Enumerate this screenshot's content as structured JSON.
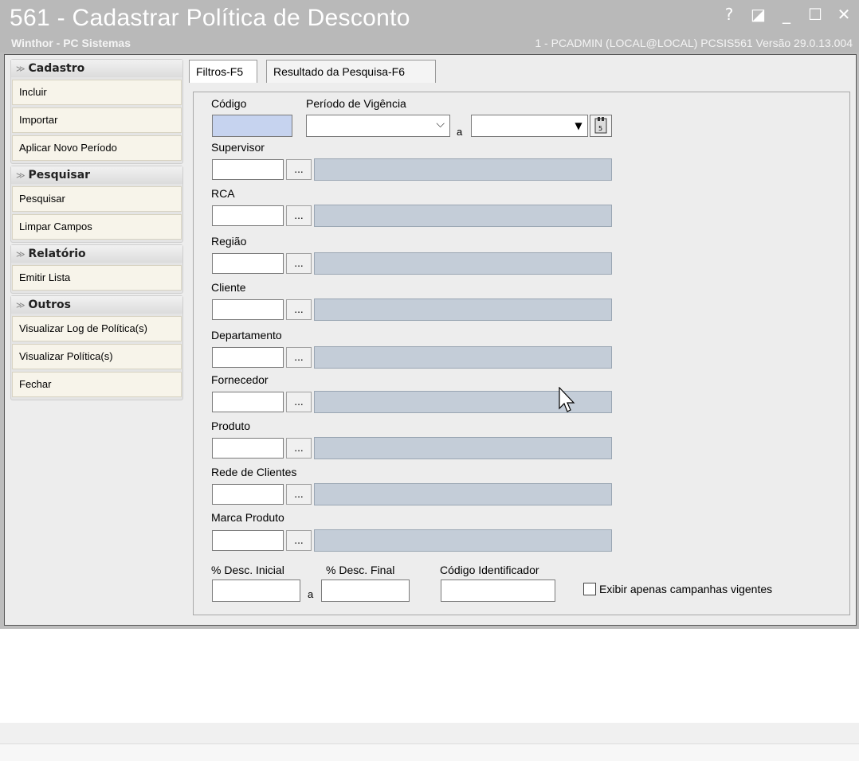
{
  "window": {
    "title": "561 - Cadastrar Política de Desconto",
    "subtitle": "Winthor - PC Sistemas",
    "userinfo": "1 - PCADMIN (LOCAL@LOCAL)   PCSIS561  Versão  29.0.13.004",
    "controls": {
      "help": "?",
      "restore": "◪",
      "minimize": "_",
      "maximize": "☐",
      "close": "✕"
    }
  },
  "sidebar": {
    "groups": [
      {
        "title": "Cadastro",
        "items": [
          "Incluir",
          "Importar",
          "Aplicar Novo Período"
        ]
      },
      {
        "title": "Pesquisar",
        "items": [
          "Pesquisar",
          "Limpar Campos"
        ]
      },
      {
        "title": "Relatório",
        "items": [
          "Emitir Lista"
        ]
      },
      {
        "title": "Outros",
        "items": [
          "Visualizar Log de Política(s)",
          "Visualizar Política(s)",
          "Fechar"
        ]
      }
    ]
  },
  "tabs": [
    {
      "label": "Filtros-F5"
    },
    {
      "label": "Resultado da Pesquisa-F6"
    }
  ],
  "filters": {
    "codigo_label": "Código",
    "periodo_label": "Período de Vigência",
    "periodo_sep": "a",
    "lookups": [
      {
        "label": "Supervisor"
      },
      {
        "label": "RCA"
      },
      {
        "label": "Região"
      },
      {
        "label": "Cliente"
      },
      {
        "label": "Departamento"
      },
      {
        "label": "Fornecedor"
      },
      {
        "label": "Produto"
      },
      {
        "label": "Rede de Clientes"
      },
      {
        "label": "Marca Produto"
      }
    ],
    "lookup_button": "...",
    "desc_inicial_label": "% Desc. Inicial",
    "desc_sep": "a",
    "desc_final_label": "% Desc. Final",
    "codigo_identificador_label": "Código Identificador",
    "vigentes_label": "Exibir apenas campanhas vigentes"
  }
}
